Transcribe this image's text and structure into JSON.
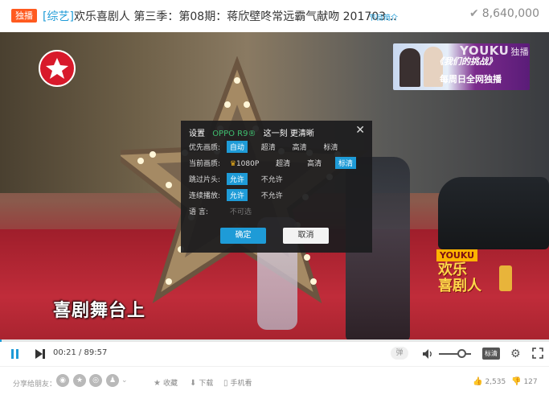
{
  "header": {
    "badge": "独播",
    "title_tag": "[综艺]",
    "title": "欢乐喜剧人 第三季：第08期：蒋欣壁咚常远霸气献吻 201703...",
    "intro_link": "节目简介",
    "views": "8,640,000"
  },
  "video": {
    "promo_line1": "《我们的挑战》",
    "promo_line2": "每周日全网独播",
    "watermark_brand": "YOUKU",
    "watermark_sub": "独播",
    "show_logo_brand": "YOUKU",
    "show_logo_name": "欢乐\n喜剧人",
    "subtitle": "喜剧舞台上"
  },
  "dialog": {
    "title": "设置",
    "sponsor": "OPPO R9®",
    "slogan": "这一刻  更清晰",
    "rows": [
      {
        "label": "优先画质:",
        "options": [
          {
            "text": "自动",
            "state": "active"
          },
          {
            "text": "超清",
            "state": ""
          },
          {
            "text": "高清",
            "state": ""
          },
          {
            "text": "标清",
            "state": ""
          }
        ]
      },
      {
        "label": "当前画质:",
        "options": [
          {
            "text": "1080P",
            "state": "crown"
          },
          {
            "text": "超清",
            "state": ""
          },
          {
            "text": "高清",
            "state": ""
          },
          {
            "text": "标清",
            "state": "active"
          }
        ]
      },
      {
        "label": "跳过片头:",
        "options": [
          {
            "text": "允许",
            "state": "active"
          },
          {
            "text": "不允许",
            "state": ""
          }
        ]
      },
      {
        "label": "连续播放:",
        "options": [
          {
            "text": "允许",
            "state": "active"
          },
          {
            "text": "不允许",
            "state": ""
          }
        ]
      },
      {
        "label": "语    言:",
        "options": [
          {
            "text": "不可选",
            "state": "disabled"
          }
        ]
      }
    ],
    "confirm": "确定",
    "cancel": "取消"
  },
  "player": {
    "progress_fraction": 0.002,
    "time": "00:21 / 89:57",
    "danmu": "弹",
    "quality": "标清"
  },
  "share": {
    "label": "分享给朋友：",
    "actions": {
      "collect": "收藏",
      "download": "下载",
      "mobile": "手机看",
      "likes": "2,535",
      "dislikes": "127"
    }
  }
}
